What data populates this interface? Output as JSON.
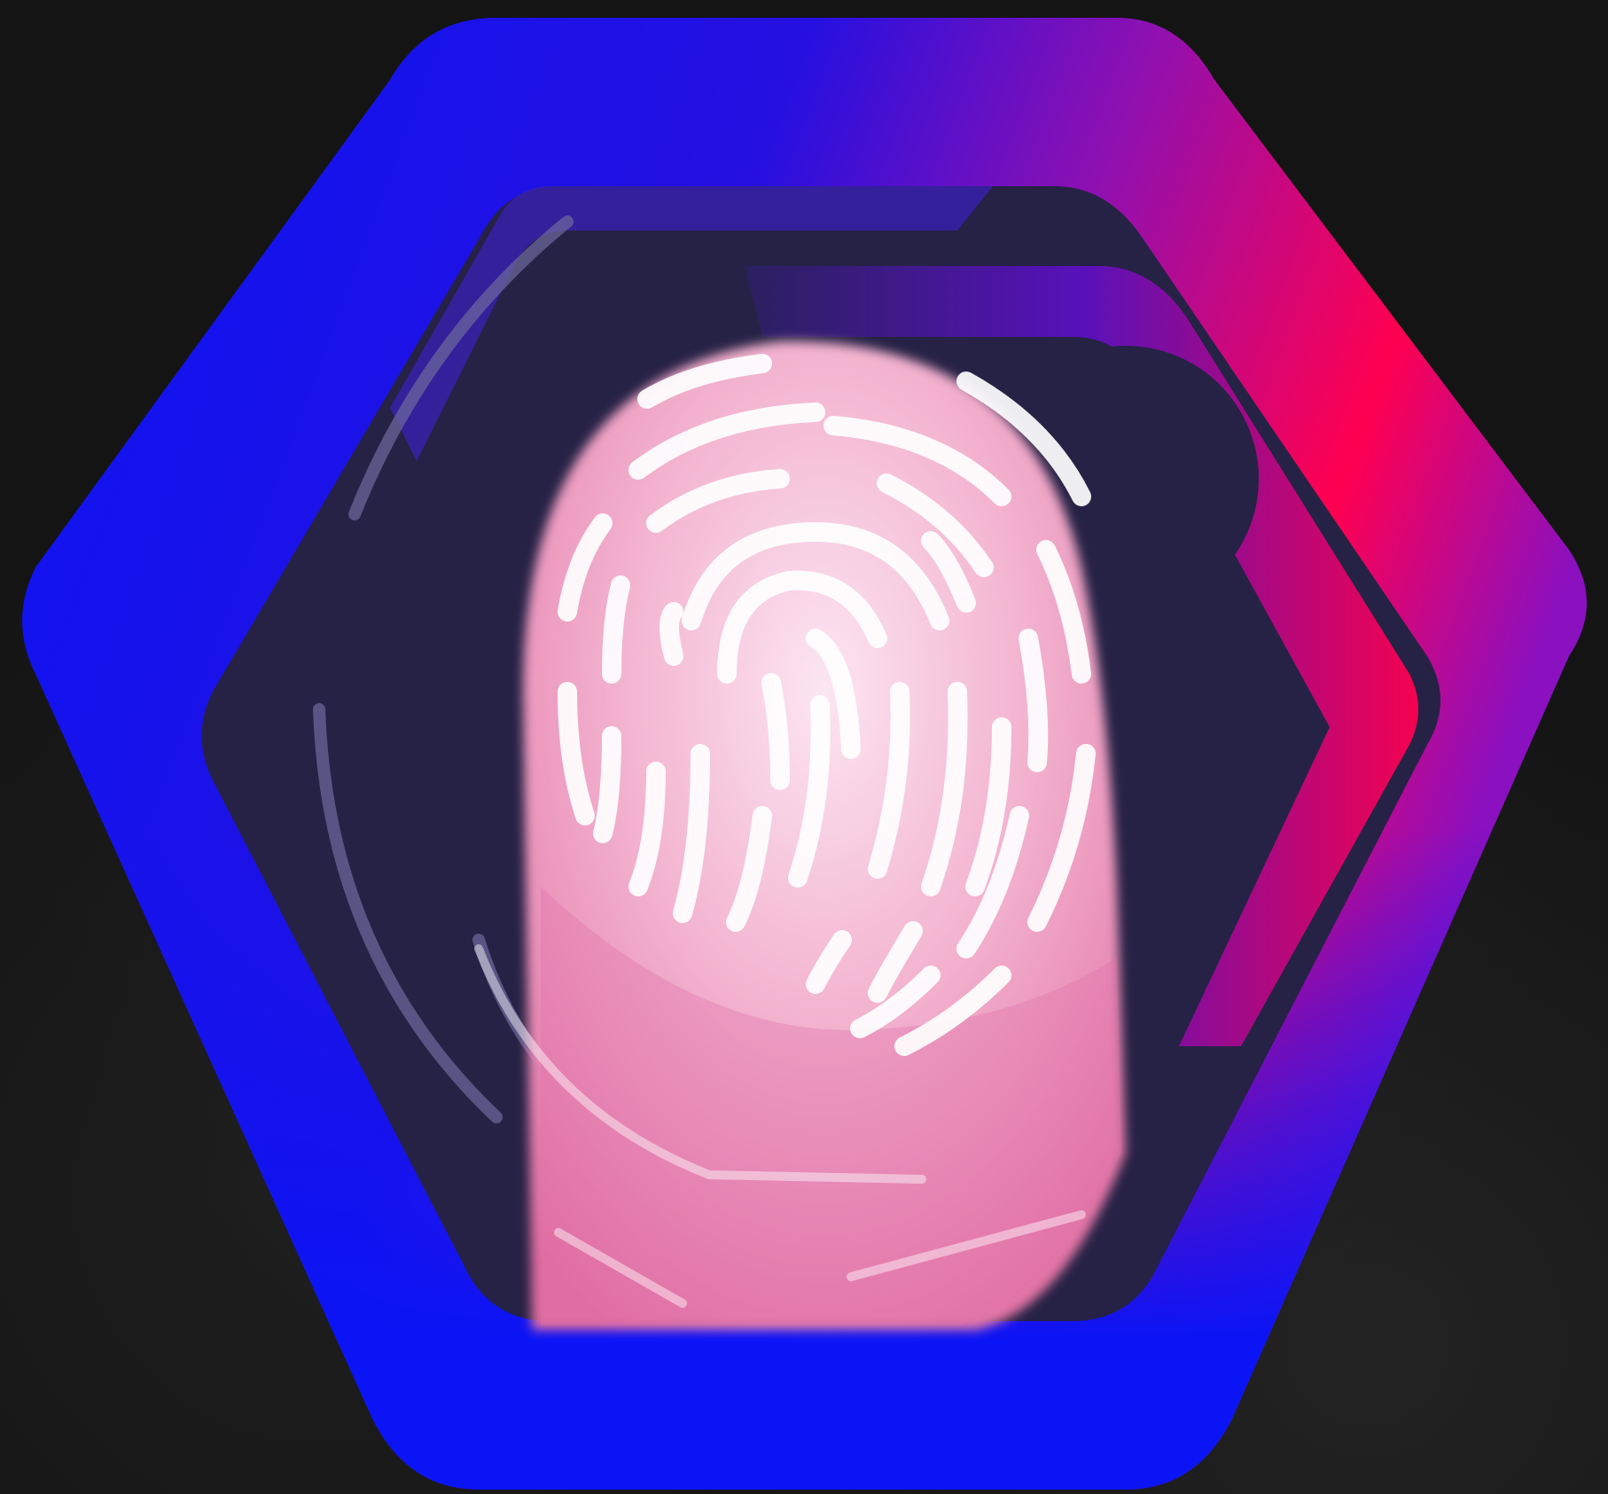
{
  "scene": {
    "subject": "fingerprint-scan-illustration",
    "icons": {
      "hexagon_frame": "hexagon-frame-icon",
      "fingerprint": "fingerprint-icon",
      "finger": "finger-icon"
    },
    "colors": {
      "background": "#141414",
      "hex_blue": "#0A14F5",
      "hex_purple": "#5A0FD0",
      "hex_pink": "#FF0050",
      "inner_dark": "#262245",
      "fingertip": "#F3B3CF",
      "fingerprint_lines": "#FFFFFF",
      "faint_ridges": "#6E6A9E"
    }
  }
}
